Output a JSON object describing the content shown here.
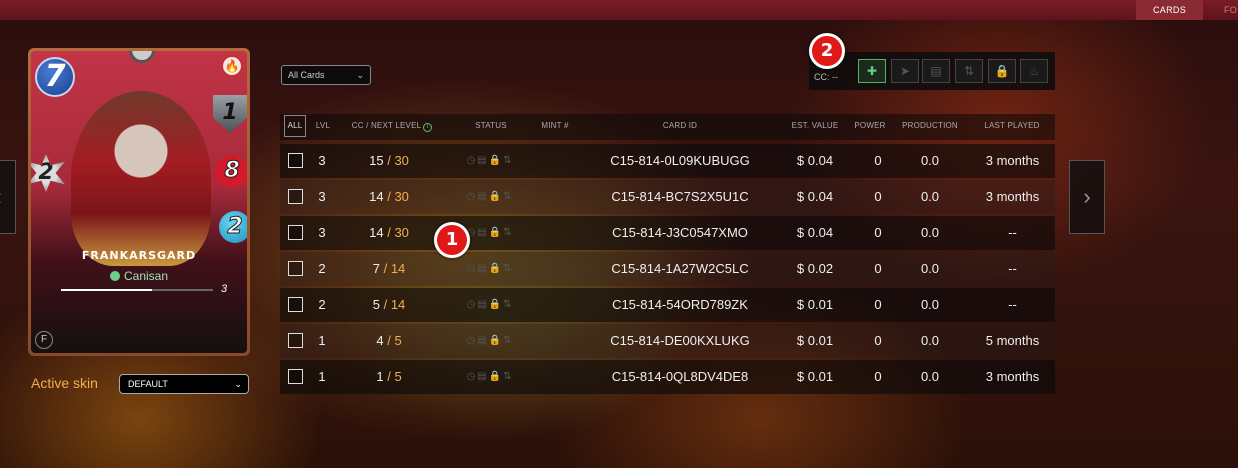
{
  "top_tabs": [
    {
      "label": "CARDS"
    },
    {
      "label": "FO"
    }
  ],
  "card": {
    "mana": "7",
    "armor": "1",
    "melee": "2",
    "health": "8",
    "speed": "2",
    "name": "FRANKARSGARD",
    "subtitle": "Canisan",
    "level": "3",
    "level_progress_fraction": 0.6,
    "element_icon": "fire-icon"
  },
  "skin": {
    "label": "Active skin",
    "value": "DEFAULT"
  },
  "filter": {
    "value": "All Cards"
  },
  "actions": {
    "cc_label": "CC: --",
    "buttons": [
      "add-to-deck-icon",
      "send-icon",
      "market-icon",
      "transfer-icon",
      "lock-icon",
      "burn-icon"
    ]
  },
  "badges": {
    "one": "1",
    "two": "2"
  },
  "table": {
    "headers": {
      "all": "ALL",
      "lvl": "LVL",
      "cc": "CC / NEXT LEVEL",
      "status": "STATUS",
      "mint": "MINT #",
      "card_id": "CARD ID",
      "est_value": "EST. VALUE",
      "power": "POWER",
      "production": "PRODUCTION",
      "last_played": "LAST PLAYED"
    },
    "rows": [
      {
        "lvl": "3",
        "cc": "15",
        "next": "30",
        "card_id": "C15-814-0L09KUBUGG",
        "value": "$ 0.04",
        "power": "0",
        "production": "0.0",
        "last": "3 months",
        "locked": false
      },
      {
        "lvl": "3",
        "cc": "14",
        "next": "30",
        "card_id": "C15-814-BC7S2X5U1C",
        "value": "$ 0.04",
        "power": "0",
        "production": "0.0",
        "last": "3 months",
        "locked": false
      },
      {
        "lvl": "3",
        "cc": "14",
        "next": "30",
        "card_id": "C15-814-J3C0547XMO",
        "value": "$ 0.04",
        "power": "0",
        "production": "0.0",
        "last": "--",
        "locked": false
      },
      {
        "lvl": "2",
        "cc": "7",
        "next": "14",
        "card_id": "C15-814-1A27W2C5LC",
        "value": "$ 0.02",
        "power": "0",
        "production": "0.0",
        "last": "--",
        "locked": false
      },
      {
        "lvl": "2",
        "cc": "5",
        "next": "14",
        "card_id": "C15-814-54ORD789ZK",
        "value": "$ 0.01",
        "power": "0",
        "production": "0.0",
        "last": "--",
        "locked": false
      },
      {
        "lvl": "1",
        "cc": "4",
        "next": "5",
        "card_id": "C15-814-DE00KXLUKG",
        "value": "$ 0.01",
        "power": "0",
        "production": "0.0",
        "last": "5 months",
        "locked": true
      },
      {
        "lvl": "1",
        "cc": "1",
        "next": "5",
        "card_id": "C15-814-0QL8DV4DE8",
        "value": "$ 0.01",
        "power": "0",
        "production": "0.0",
        "last": "3 months",
        "locked": false
      }
    ]
  }
}
